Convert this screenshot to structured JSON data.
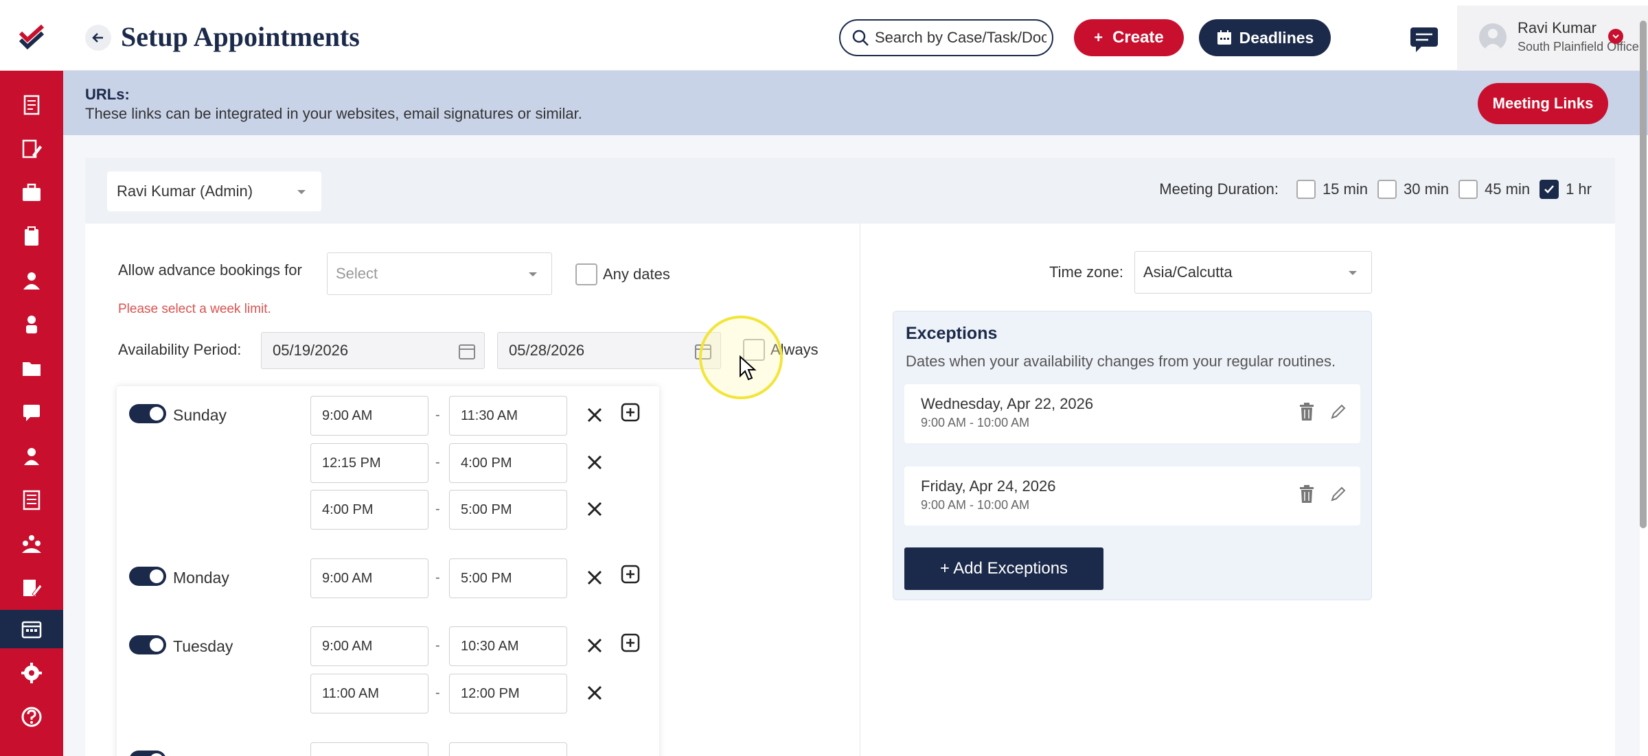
{
  "header": {
    "title": "Setup Appointments",
    "search_placeholder": "Search by Case/Task/Document",
    "create_label": "Create",
    "deadlines_label": "Deadlines",
    "user_name": "Ravi Kumar",
    "user_office": "South Plainfield Office"
  },
  "url_band": {
    "title": "URLs:",
    "description": "These links can be integrated in your websites, email signatures or similar.",
    "meeting_links_label": "Meeting Links"
  },
  "controls": {
    "selected_user": "Ravi Kumar (Admin)",
    "meeting_duration_label": "Meeting Duration:",
    "durations": [
      {
        "label": "15 min",
        "checked": false
      },
      {
        "label": "30 min",
        "checked": false
      },
      {
        "label": "45 min",
        "checked": false
      },
      {
        "label": "1 hr",
        "checked": true
      }
    ]
  },
  "booking": {
    "advance_label": "Allow advance bookings for",
    "advance_placeholder": "Select",
    "any_dates_label": "Any dates",
    "error": "Please select a week limit.",
    "availability_label": "Availability Period:",
    "start_date": "05/19/2026",
    "end_date": "05/28/2026",
    "always_label": "Always"
  },
  "days": [
    {
      "name": "Sunday",
      "slots": [
        [
          "9:00 AM",
          "11:30 AM"
        ],
        [
          "12:15 PM",
          "4:00 PM"
        ],
        [
          "4:00 PM",
          "5:00 PM"
        ]
      ]
    },
    {
      "name": "Monday",
      "slots": [
        [
          "9:00 AM",
          "5:00 PM"
        ]
      ]
    },
    {
      "name": "Tuesday",
      "slots": [
        [
          "9:00 AM",
          "10:30 AM"
        ],
        [
          "11:00 AM",
          "12:00 PM"
        ]
      ]
    }
  ],
  "timezone": {
    "label": "Time zone:",
    "value": "Asia/Calcutta"
  },
  "exceptions": {
    "title": "Exceptions",
    "description": "Dates when your availability changes from your regular routines.",
    "items": [
      {
        "date": "Wednesday, Apr 22, 2026",
        "time": "9:00 AM - 10:00 AM"
      },
      {
        "date": "Friday, Apr 24, 2026",
        "time": "9:00 AM - 10:00 AM"
      }
    ],
    "add_label": "+ Add Exceptions"
  },
  "colors": {
    "brand_red": "#c8102e",
    "navy": "#1b2a4a"
  }
}
